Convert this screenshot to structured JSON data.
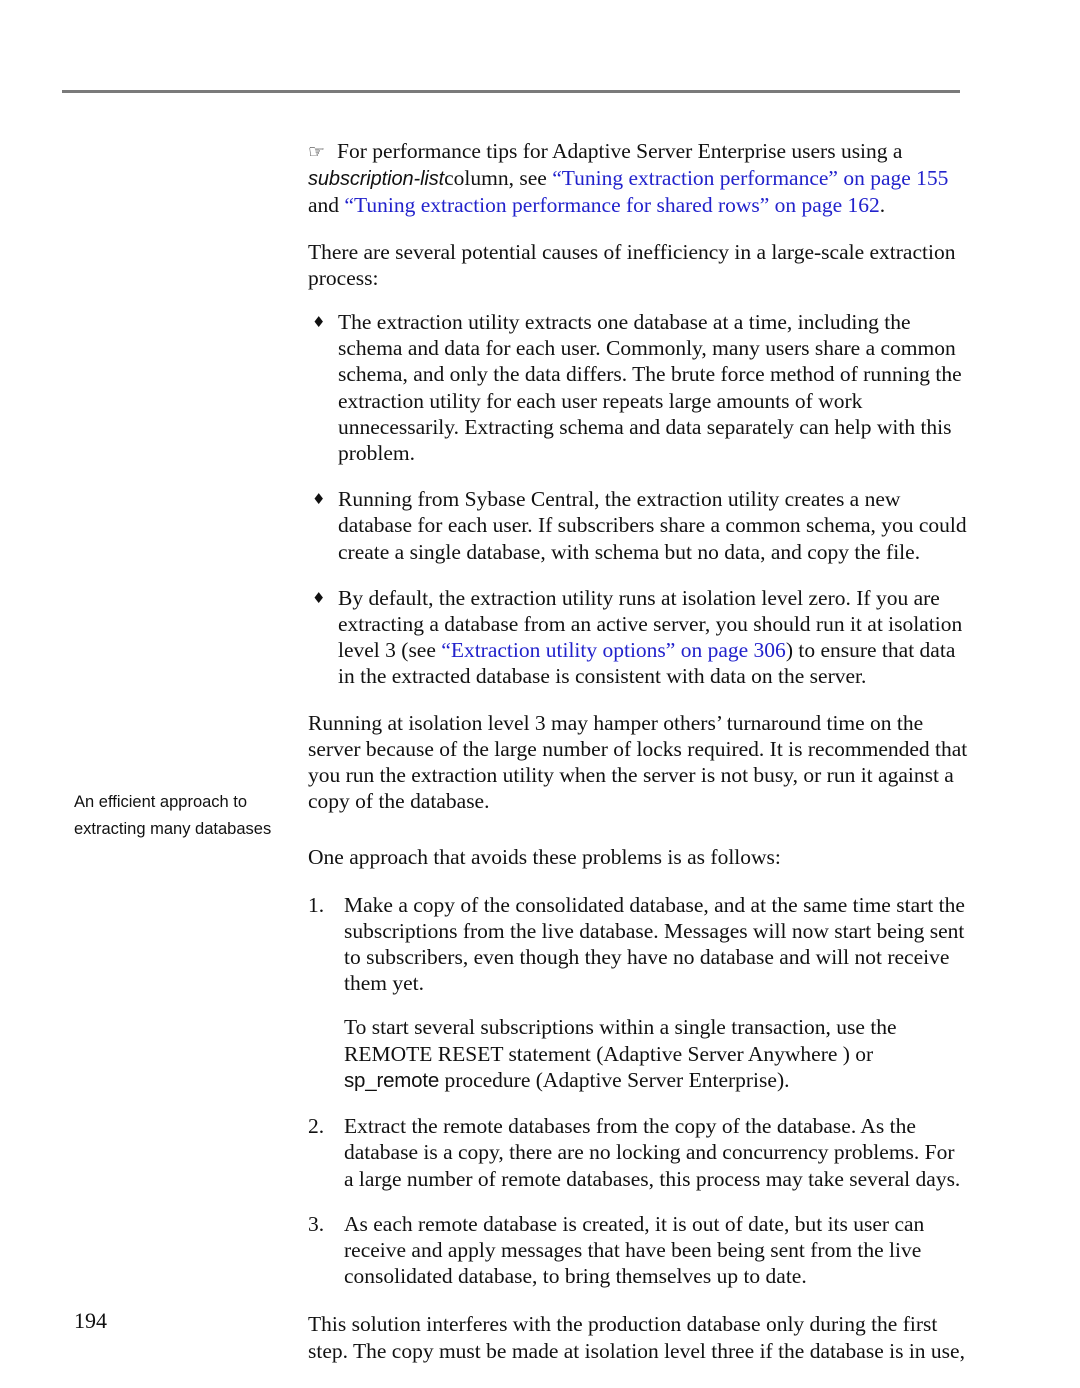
{
  "page": {
    "number": "194",
    "rule_color": "#7a7a7a",
    "link_color": "#2222cc"
  },
  "note": {
    "icon": "pointing-hand-icon",
    "icon_glyph": "☞",
    "text_before_italic": "For performance tips for Adaptive Server Enterprise users using a ",
    "italic_term": "subscription-list",
    "text_after_italic": "column, see ",
    "link1": "“Tuning extraction performance” on page 155",
    "between_links": " and ",
    "link2": "“Tuning extraction performance for shared rows” on page 162",
    "trailing": "."
  },
  "intro_paragraph": "There are several potential causes of inefficiency in a large-scale extraction process:",
  "bullets": [
    {
      "glyph": "♦",
      "text": "The extraction utility extracts one database at a time, including the schema and data for each user. Commonly, many users share a common schema, and only the data differs. The brute force method of running the extraction utility for each user repeats large amounts of work unnecessarily. Extracting schema and data separately can help with this problem."
    },
    {
      "glyph": "♦",
      "text": "Running from Sybase Central, the extraction utility creates a new database for each user. If subscribers share a common schema, you could create a single database, with schema but no data, and copy the file."
    },
    {
      "glyph": "♦",
      "text_part1": "By default, the extraction utility runs at isolation level zero. If you are extracting a database from an active server, you should run it at isolation level 3 (see ",
      "link": "“Extraction utility options” on page 306",
      "text_part2": ") to ensure that data in the extracted database is consistent with data on the server."
    }
  ],
  "after_bullets_paragraph": "Running at isolation level 3 may hamper others’ turnaround time on the server because of the large number of locks required. It is recommended that you run the extraction utility when the server is not busy, or run it against a copy of the database.",
  "margin_note": "An efficient approach to extracting many databases",
  "approach_lead_in": "One approach that avoids these problems is as follows:",
  "steps": [
    {
      "number": "1.",
      "text": "Make a copy of the consolidated database, and at the same time start the subscriptions from the live database. Messages will now start being sent to subscribers, even though they have no database and will not receive them yet.",
      "sub_text_part1": "To start several subscriptions within a single transaction, use the REMOTE RESET statement (Adaptive Server Anywhere ) or ",
      "sub_code": "sp_remote",
      "sub_text_part2": " procedure (Adaptive Server Enterprise)."
    },
    {
      "number": "2.",
      "text": "Extract the remote databases from the copy of the database. As the database is a copy, there are no locking and concurrency problems. For a large number of remote databases, this process may take several days."
    },
    {
      "number": "3.",
      "text": "As each remote database is created, it is out of date, but its user can receive and apply messages that have been being sent from the live consolidated database, to bring themselves up to date."
    }
  ],
  "closing_paragraph": "This solution interferes with the production database only during the first step. The copy must be made at isolation level three if the database is in use,"
}
